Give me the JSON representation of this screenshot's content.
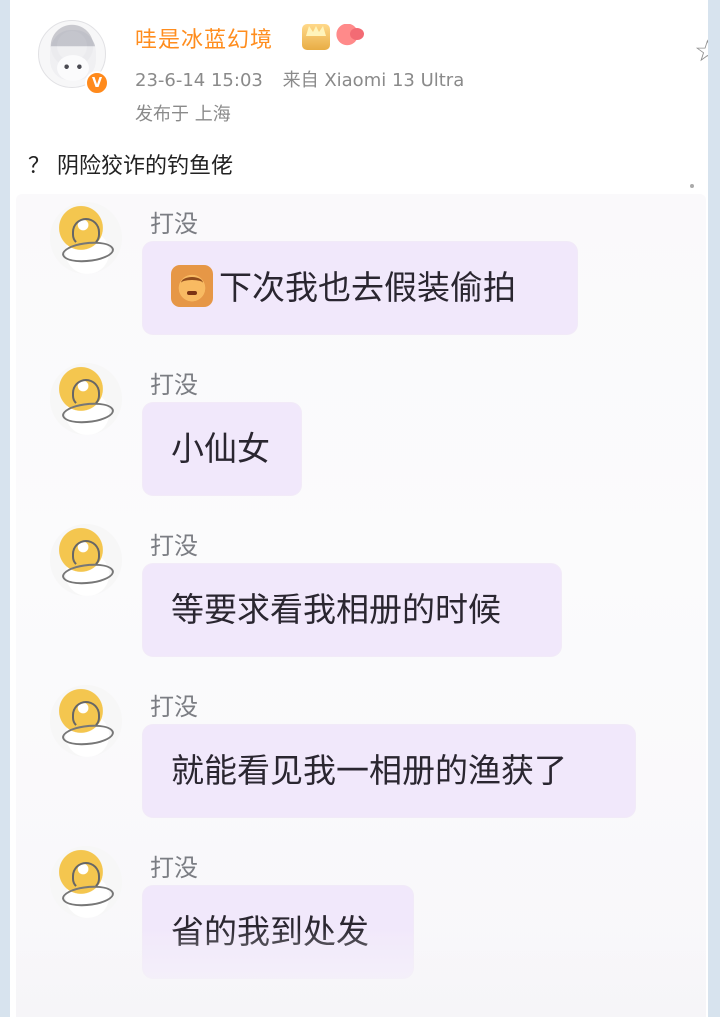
{
  "post": {
    "username": "哇是冰蓝幻境",
    "time": "23-6-14 15:03",
    "source": "来自 Xiaomi 13 Ultra",
    "location": "发布于 上海",
    "text": "？ 阴险狡诈的钓鱼佬"
  },
  "icons": {
    "avatar": "user-avatar",
    "verify": "verified-badge-icon",
    "crown": "crown-icon",
    "shrimp": "shrimp-icon",
    "star": "star-icon",
    "emoji": "face-emoji-icon"
  },
  "chat": {
    "messages": [
      {
        "sender": "打没",
        "text": "下次我也去假装偷拍"
      },
      {
        "sender": "打没",
        "text": "小仙女"
      },
      {
        "sender": "打没",
        "text": "等要求看我相册的时候"
      },
      {
        "sender": "打没",
        "text": "就能看见我一相册的渔获了"
      },
      {
        "sender": "打没",
        "text": "省的我到处发"
      }
    ]
  },
  "colors": {
    "username": "#ff8d1e",
    "meta": "#8a8a8a",
    "bubble": "#f1e8fb",
    "frame": "#d7e3ee"
  }
}
